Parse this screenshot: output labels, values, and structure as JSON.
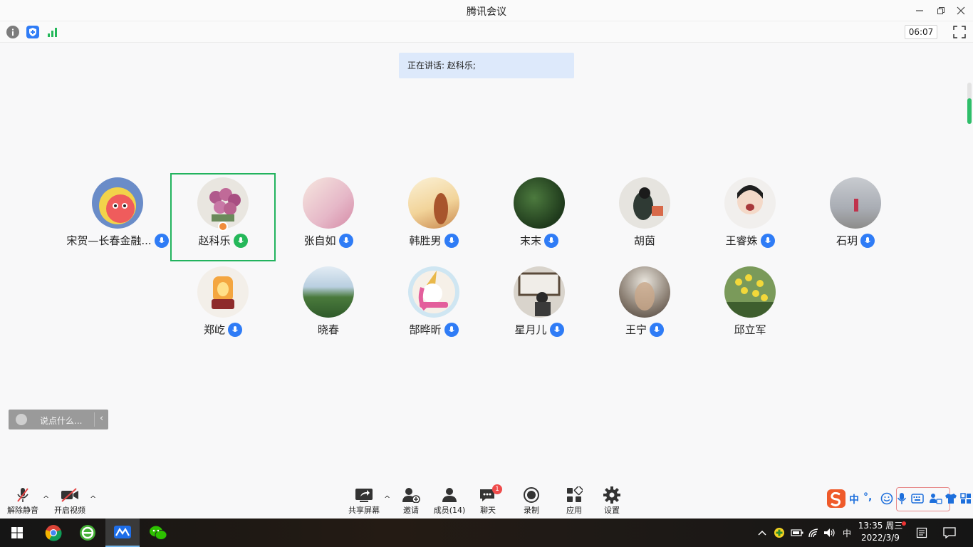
{
  "window": {
    "title": "腾讯会议"
  },
  "subbar": {
    "timer": "06:07"
  },
  "speaking": {
    "text": "正在讲话: 赵科乐;"
  },
  "participants": [
    {
      "name": "宋贺—长春金融...",
      "mic": "blue"
    },
    {
      "name": "赵科乐",
      "mic": "green",
      "active": true,
      "host": true
    },
    {
      "name": "张自如",
      "mic": "blue"
    },
    {
      "name": "韩胜男",
      "mic": "blue"
    },
    {
      "name": "末末",
      "mic": "blue"
    },
    {
      "name": "胡茵",
      "mic": "none"
    },
    {
      "name": "王睿姝",
      "mic": "blue"
    },
    {
      "name": "石玥",
      "mic": "blue"
    },
    {
      "name": "郑屹",
      "mic": "blue"
    },
    {
      "name": "晓春",
      "mic": "none"
    },
    {
      "name": "郜晔昕",
      "mic": "blue"
    },
    {
      "name": "星月儿",
      "mic": "blue"
    },
    {
      "name": "王宁",
      "mic": "blue"
    },
    {
      "name": "邱立军",
      "mic": "none"
    }
  ],
  "chat": {
    "placeholder": "说点什么..."
  },
  "toolbar": {
    "unmute": "解除静音",
    "start_video": "开启视频",
    "share_screen": "共享屏幕",
    "invite": "邀请",
    "members": "成员(14)",
    "chat": "聊天",
    "chat_badge": "1",
    "record": "录制",
    "apps": "应用",
    "settings": "设置"
  },
  "ime": {
    "lang": "中",
    "punct": "°,"
  },
  "taskbar": {
    "ime_lang": "中",
    "time": "13:35 周三",
    "date": "2022/3/9"
  },
  "colors": {
    "active_border": "#22b35e",
    "mic_blue": "#2f7cf6",
    "mic_green": "#25b85a",
    "banner": "#dde9fb",
    "badge_red": "#ef4b4b"
  }
}
